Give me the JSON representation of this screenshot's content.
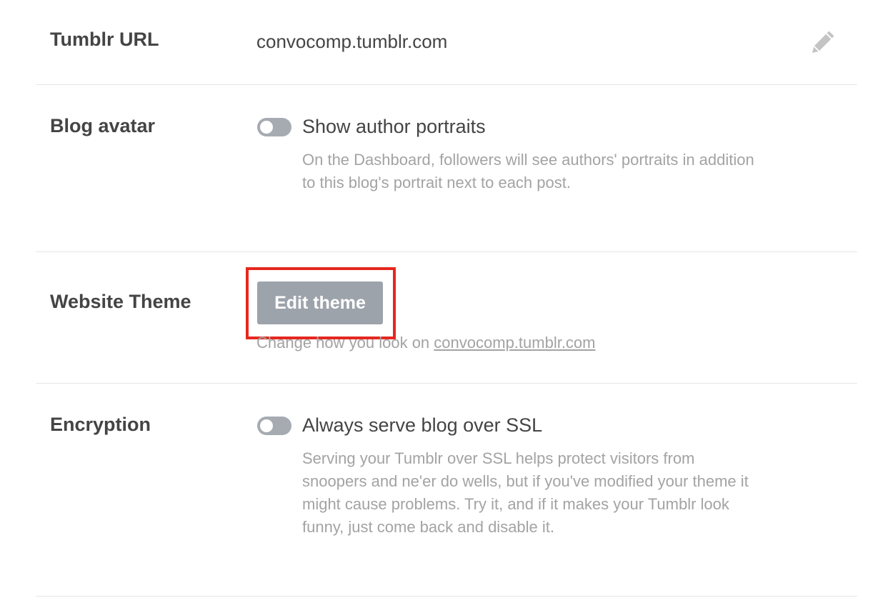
{
  "tumblr_url": {
    "label": "Tumblr URL",
    "value": "convocomp.tumblr.com",
    "edit_icon": "pencil-icon"
  },
  "blog_avatar": {
    "label": "Blog avatar",
    "toggle_on": false,
    "toggle_label": "Show author portraits",
    "help": "On the Dashboard, followers will see authors' portraits in addition to this blog's portrait next to each post."
  },
  "website_theme": {
    "label": "Website Theme",
    "button_label": "Edit theme",
    "help_prefix": "Change how you look on ",
    "help_link": "convocomp.tumblr.com",
    "highlight_color": "#e5281f"
  },
  "encryption": {
    "label": "Encryption",
    "toggle_on": false,
    "toggle_label": "Always serve blog over SSL",
    "help": "Serving your Tumblr over SSL helps protect visitors from snoopers and ne'er do wells, but if you've modified your theme it might cause problems. Try it, and if it makes your Tumblr look funny, just come back and disable it."
  }
}
